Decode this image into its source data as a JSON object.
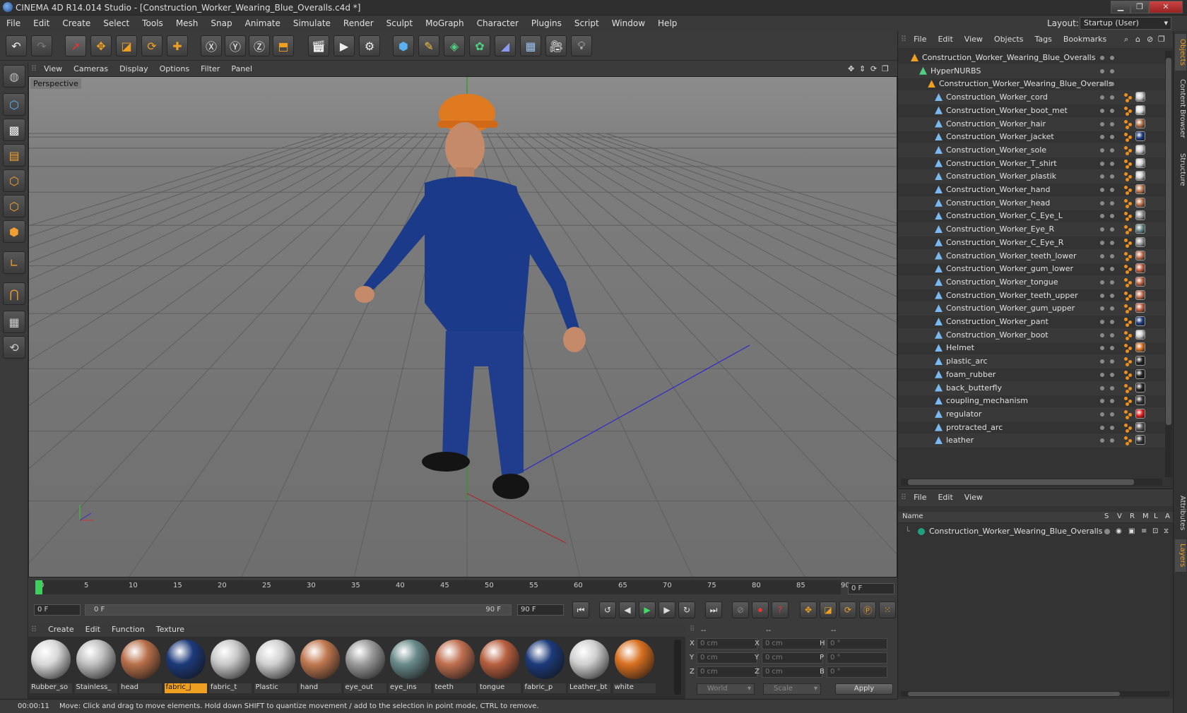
{
  "window": {
    "title": "CINEMA 4D R14.014 Studio - [Construction_Worker_Wearing_Blue_Overalls.c4d *]"
  },
  "menu": [
    "File",
    "Edit",
    "Create",
    "Select",
    "Tools",
    "Mesh",
    "Snap",
    "Animate",
    "Simulate",
    "Render",
    "Sculpt",
    "MoGraph",
    "Character",
    "Plugins",
    "Script",
    "Window",
    "Help"
  ],
  "layout": {
    "label": "Layout:",
    "value": "Startup (User)"
  },
  "viewport": {
    "menu": [
      "View",
      "Cameras",
      "Display",
      "Options",
      "Filter",
      "Panel"
    ],
    "label": "Perspective"
  },
  "timeline": {
    "ticks": [
      "0",
      "5",
      "10",
      "15",
      "20",
      "25",
      "30",
      "35",
      "40",
      "45",
      "50",
      "55",
      "60",
      "65",
      "70",
      "75",
      "80",
      "85",
      "90"
    ],
    "current_frame": "0 F",
    "start": "0 F",
    "range_start": "0 F",
    "range_end": "90 F",
    "end": "90 F"
  },
  "materials": {
    "menu": [
      "Create",
      "Edit",
      "Function",
      "Texture"
    ],
    "items": [
      {
        "label": "Rubber_so",
        "color": "#d8d8d8"
      },
      {
        "label": "Stainless_",
        "color": "#c0c0c0"
      },
      {
        "label": "head",
        "color": "#b8704a"
      },
      {
        "label": "fabric_j",
        "color": "#1c3a7a"
      },
      {
        "label": "fabric_t",
        "color": "#c8c8c8"
      },
      {
        "label": "Plastic",
        "color": "#d0d0d0"
      },
      {
        "label": "hand",
        "color": "#c07850"
      },
      {
        "label": "eye_out",
        "color": "#9a9a9a"
      },
      {
        "label": "eye_ins",
        "color": "#6a8a8a"
      },
      {
        "label": "teeth",
        "color": "#c07050"
      },
      {
        "label": "tongue",
        "color": "#b86040"
      },
      {
        "label": "fabric_p",
        "color": "#1c3a7a"
      },
      {
        "label": "Leather_bt",
        "color": "#cfcfcf"
      },
      {
        "label": "white",
        "color": "#d87020"
      }
    ]
  },
  "coords": {
    "headers": [
      "--",
      "--",
      "--"
    ],
    "rows": [
      {
        "a": "X",
        "av": "0 cm",
        "b": "X",
        "bv": "0 cm",
        "c": "H",
        "cv": "0 °"
      },
      {
        "a": "Y",
        "av": "0 cm",
        "b": "Y",
        "bv": "0 cm",
        "c": "P",
        "cv": "0 °"
      },
      {
        "a": "Z",
        "av": "0 cm",
        "b": "Z",
        "bv": "0 cm",
        "c": "B",
        "cv": "0 °"
      }
    ],
    "world": "World",
    "scale": "Scale",
    "apply": "Apply"
  },
  "status": {
    "time": "00:00:11",
    "message": "Move: Click and drag to move elements. Hold down SHIFT to quantize movement / add to the selection in point mode, CTRL to remove."
  },
  "objects": {
    "menu": [
      "File",
      "Edit",
      "View",
      "Objects",
      "Tags",
      "Bookmarks"
    ],
    "root": "Construction_Worker_Wearing_Blue_Overalls",
    "nurbs": "HyperNURBS",
    "group": "Construction_Worker_Wearing_Blue_Overalls",
    "items": [
      {
        "name": "Construction_Worker_cord",
        "tag": "#cfcfcf"
      },
      {
        "name": "Construction_Worker_boot_met",
        "tag": "#e0e0e0"
      },
      {
        "name": "Construction_Worker_hair",
        "tag": "#b0704a"
      },
      {
        "name": "Construction_Worker_jacket",
        "tag": "#1c3a7a"
      },
      {
        "name": "Construction_Worker_sole",
        "tag": "#d0d0d0"
      },
      {
        "name": "Construction_Worker_T_shirt",
        "tag": "#d0d0d0"
      },
      {
        "name": "Construction_Worker_plastik",
        "tag": "#d0d0d0"
      },
      {
        "name": "Construction_Worker_hand",
        "tag": "#c07850"
      },
      {
        "name": "Construction_Worker_head",
        "tag": "#b8704a"
      },
      {
        "name": "Construction_Worker_C_Eye_L",
        "tag": "#9a9a9a"
      },
      {
        "name": "Construction_Worker_Eye_R",
        "tag": "#6a8a8a"
      },
      {
        "name": "Construction_Worker_C_Eye_R",
        "tag": "#9a9a9a"
      },
      {
        "name": "Construction_Worker_teeth_lower",
        "tag": "#c07050"
      },
      {
        "name": "Construction_Worker_gum_lower",
        "tag": "#c06040"
      },
      {
        "name": "Construction_Worker_tongue",
        "tag": "#b86040"
      },
      {
        "name": "Construction_Worker_teeth_upper",
        "tag": "#c07050"
      },
      {
        "name": "Construction_Worker_gum_upper",
        "tag": "#c06040"
      },
      {
        "name": "Construction_Worker_pant",
        "tag": "#1c3a7a"
      },
      {
        "name": "Construction_Worker_boot",
        "tag": "#cfcfcf"
      },
      {
        "name": "Helmet",
        "tag": "#d87020"
      },
      {
        "name": "plastic_arc",
        "tag": "#222222"
      },
      {
        "name": "foam_rubber",
        "tag": "#222222"
      },
      {
        "name": "back_butterfly",
        "tag": "#222222"
      },
      {
        "name": "coupling_mechanism",
        "tag": "#333333"
      },
      {
        "name": "regulator",
        "tag": "#dd2020"
      },
      {
        "name": "protracted_arc",
        "tag": "#555555"
      },
      {
        "name": "leather",
        "tag": "#333333"
      }
    ]
  },
  "layers": {
    "menu": [
      "File",
      "Edit",
      "View"
    ],
    "headers": {
      "name": "Name",
      "s": "S",
      "v": "V",
      "r": "R",
      "m": "M",
      "l": "L",
      "a": "A"
    },
    "items": [
      "Construction_Worker_Wearing_Blue_Overalls"
    ]
  },
  "side_tabs": [
    "Objects",
    "Content Browser",
    "Structure",
    "Attributes",
    "Layers"
  ],
  "colors": {
    "accent": "#f0a020",
    "panel": "#3b3b3b",
    "dark": "#2e2e2e"
  }
}
